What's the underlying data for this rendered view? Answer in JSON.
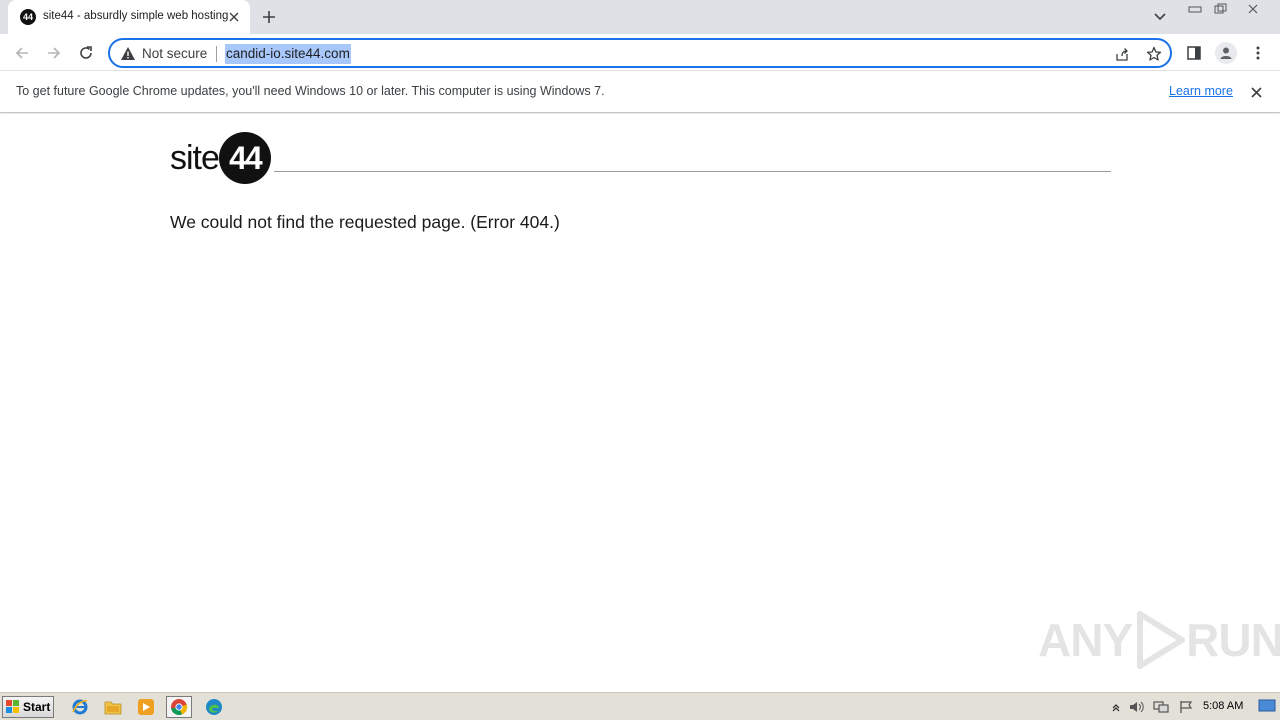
{
  "browser": {
    "tab": {
      "title": "site44 - absurdly simple web hosting",
      "favicon_text": "44"
    },
    "address_bar": {
      "security_label": "Not secure",
      "url": "candid-io.site44.com"
    },
    "infobar": {
      "message": "To get future Google Chrome updates, you'll need Windows 10 or later. This computer is using Windows 7.",
      "link": "Learn more"
    }
  },
  "page": {
    "logo_text": "site",
    "logo_badge": "44",
    "error_message": "We could not find the requested page. (Error 404.)"
  },
  "watermark": {
    "text": "ANY",
    "text2": "RUN"
  },
  "taskbar": {
    "start_label": "Start",
    "clock": "5:08 AM"
  },
  "colors": {
    "accent": "#1a73e8",
    "tabstrip": "#dee1e6",
    "url_highlight": "#a8c7fa"
  }
}
